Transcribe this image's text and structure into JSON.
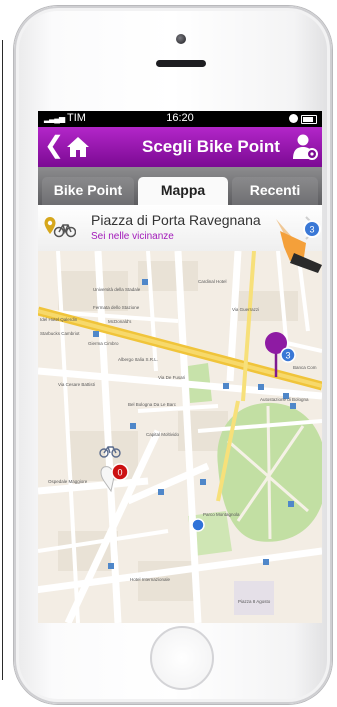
{
  "status_bar": {
    "carrier": "TIM",
    "time": "16:20"
  },
  "nav": {
    "title": "Scegli Bike Point"
  },
  "tabs": [
    {
      "label": "Bike Point",
      "selected": false
    },
    {
      "label": "Mappa",
      "selected": true
    },
    {
      "label": "Recenti",
      "selected": false
    }
  ],
  "location": {
    "name": "Piazza di Porta Ravegnana",
    "subtitle": "Sei nelle vicinanze",
    "badge": "3"
  },
  "map": {
    "labels": [
      "Cardinal Hotel",
      "Università della Stadale",
      "Fermata dello Stazione",
      "McDonald's",
      "Idel Hotel Qalerdin",
      "Starbucks Cambriot",
      "Gierma Cimbro",
      "Albergo Italia S.R.L.",
      "Via Cesare Battisti",
      "Banca Com",
      "Via Guerrazzi",
      "Via De Fusari",
      "Bel Bologna Da Le Barc",
      "Autostazione di Bologna",
      "Capital Moltivido",
      "Ospedale Maggiore",
      "Parco Montagnola",
      "Hotel Internazionale",
      "Piazza 8 Agosto"
    ],
    "markers": [
      {
        "type": "bike-station",
        "badge": "3",
        "color": "#8e1ba3"
      },
      {
        "type": "bike-station",
        "badge": "0",
        "color": "#cc1111"
      },
      {
        "type": "current-location",
        "color": "#2f72d8"
      }
    ]
  },
  "colors": {
    "accent": "#8e1ba3",
    "nav_top": "#b326c9",
    "nav_bottom": "#7b0a93",
    "badge_blue": "#3a78d6"
  }
}
